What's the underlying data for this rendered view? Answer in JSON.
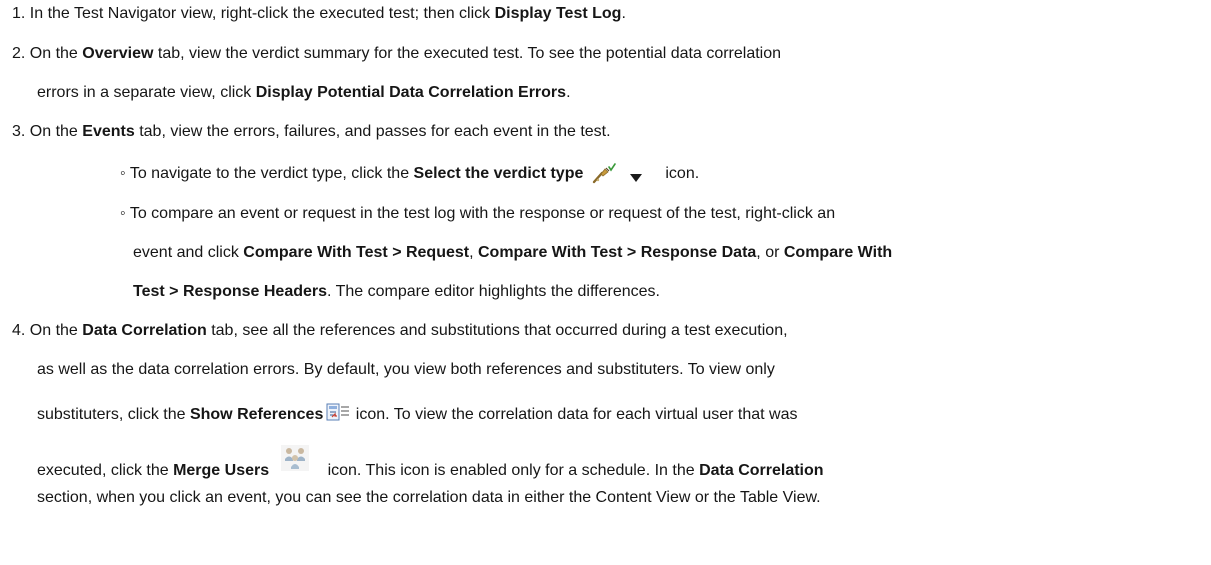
{
  "steps": [
    {
      "num": "1.",
      "a": "In the Test Navigator view, right-click the executed test; then click ",
      "b1": "Display Test Log",
      "c": "."
    },
    {
      "num": "2.",
      "a": "On the ",
      "b1": "Overview",
      "c": " tab, view the verdict summary for the executed test. To see the potential data correlation",
      "d": "errors in a separate view, click ",
      "b2": "Display Potential Data Correlation Errors",
      "e": "."
    },
    {
      "num": "3.",
      "a": "On the ",
      "b1": "Events",
      "c": " tab, view the errors, failures, and passes for each event in the test."
    },
    {
      "num": "4.",
      "a": "On the ",
      "b1": "Data Correlation",
      "c": " tab, see all the references and substitutions that occurred during a test execution,",
      "d": "as well as the data correlation errors. By default, you view both references and substituters. To view only",
      "e": "substituters, click the ",
      "b2": "Show References",
      "f": " icon. To view the correlation data for each virtual user that was",
      "g": "executed, click the ",
      "b3": "Merge Users",
      "h": " icon. This icon is enabled only for a schedule. In the ",
      "b4": "Data Correlation",
      "i": "section, when you click an event, you can see the correlation data in either the Content View or the Table View."
    }
  ],
  "bullets": [
    {
      "mark": "◦",
      "a": " To navigate to the verdict type, click the ",
      "b1": "Select the verdict type",
      "c": "icon."
    },
    {
      "mark": "◦",
      "a": " To compare an event or request in the test log with the response or request of the test, right-click an",
      "b": "event and click ",
      "b1": "Compare With Test > Request",
      "c": ", ",
      "b2": "Compare With Test > Response Data",
      "d": ", or ",
      "b3": "Compare With",
      "b4": "Test > Response Headers",
      "e": ". The compare editor highlights the differences."
    }
  ],
  "icons": {
    "verdict": "select-verdict-type-icon",
    "dropdown": "dropdown-arrow-icon",
    "show_references": "show-references-icon",
    "merge_users": "merge-users-icon"
  }
}
